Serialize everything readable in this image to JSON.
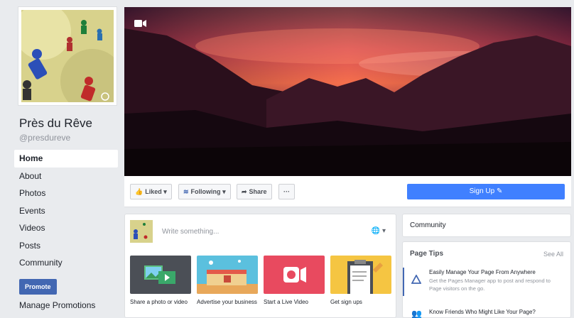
{
  "page": {
    "name": "Près du Rêve",
    "handle": "@presdureve"
  },
  "sidebar": {
    "items": [
      {
        "label": "Home",
        "active": true
      },
      {
        "label": "About"
      },
      {
        "label": "Photos"
      },
      {
        "label": "Events"
      },
      {
        "label": "Videos"
      },
      {
        "label": "Posts"
      },
      {
        "label": "Community"
      }
    ],
    "promote_label": "Promote",
    "manage_promotions": "Manage Promotions"
  },
  "action_bar": {
    "liked": "Liked",
    "following": "Following",
    "share": "Share",
    "more": "···",
    "signup": "Sign Up"
  },
  "composer": {
    "placeholder": "Write something...",
    "tiles": [
      {
        "label": "Share a photo or video",
        "color": "#4b4f56"
      },
      {
        "label": "Advertise your business",
        "color": "#5bc0de"
      },
      {
        "label": "Start a Live Video",
        "color": "#e84a5f"
      },
      {
        "label": "Get sign ups",
        "color": "#f5c542"
      }
    ]
  },
  "right": {
    "community_title": "Community",
    "tips_title": "Page Tips",
    "see_all": "See All",
    "tips": [
      {
        "title": "Easily Manage Your Page From Anywhere",
        "desc": "Get the Pages Manager app to post and respond to Page visitors on the go."
      },
      {
        "title": "Know Friends Who Might Like Your Page?",
        "desc": ""
      }
    ]
  },
  "colors": {
    "brand": "#4267b2",
    "signup": "#4080ff",
    "background": "#e9ebee"
  }
}
